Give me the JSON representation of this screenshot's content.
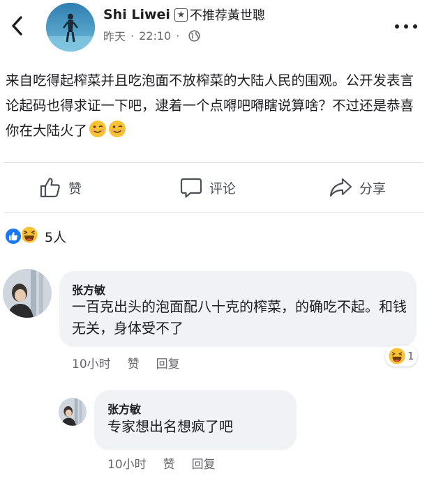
{
  "header": {
    "user_name": "Shi Liwei",
    "user_note": "不推荐黃世聰",
    "time_day": "昨天",
    "time_separator": "·",
    "time_clock": "22:10",
    "time_separator2": "·"
  },
  "post": {
    "text": "来自吃得起榨菜并且吃泡面不放榨菜的大陆人民的围观。公开发表言论起码也得求证一下吧，逮着一个点嘚吧嘚瞎说算啥？不过还是恭喜你在大陆火了"
  },
  "actions": {
    "like_label": "赞",
    "comment_label": "评论",
    "share_label": "分享"
  },
  "reactions": {
    "count": "5人"
  },
  "comments": [
    {
      "author": "张方敏",
      "text": "一百克出头的泡面配八十克的榨菜，的确吃不起。和钱无关，身体受不了",
      "time": "10小时",
      "like_label": "赞",
      "reply_label": "回复",
      "reaction_count": "1"
    },
    {
      "author": "张方敏",
      "text": "专家想出名想疯了吧",
      "time": "10小时",
      "like_label": "赞",
      "reply_label": "回复"
    }
  ],
  "icons": {
    "back": "chevron-left-icon",
    "badge": "star-badge-icon",
    "globe": "globe-icon",
    "more": "more-dots-icon",
    "like": "thumbs-up-icon",
    "comment": "speech-bubble-icon",
    "share": "share-arrow-icon",
    "wink": "wink-emoji-icon",
    "haha": "haha-emoji-icon"
  },
  "colors": {
    "like_blue": "#1877f2",
    "bubble_bg": "#f0f2f5",
    "secondary_text": "#65676b",
    "emoji_yellow": "#f7c233"
  }
}
